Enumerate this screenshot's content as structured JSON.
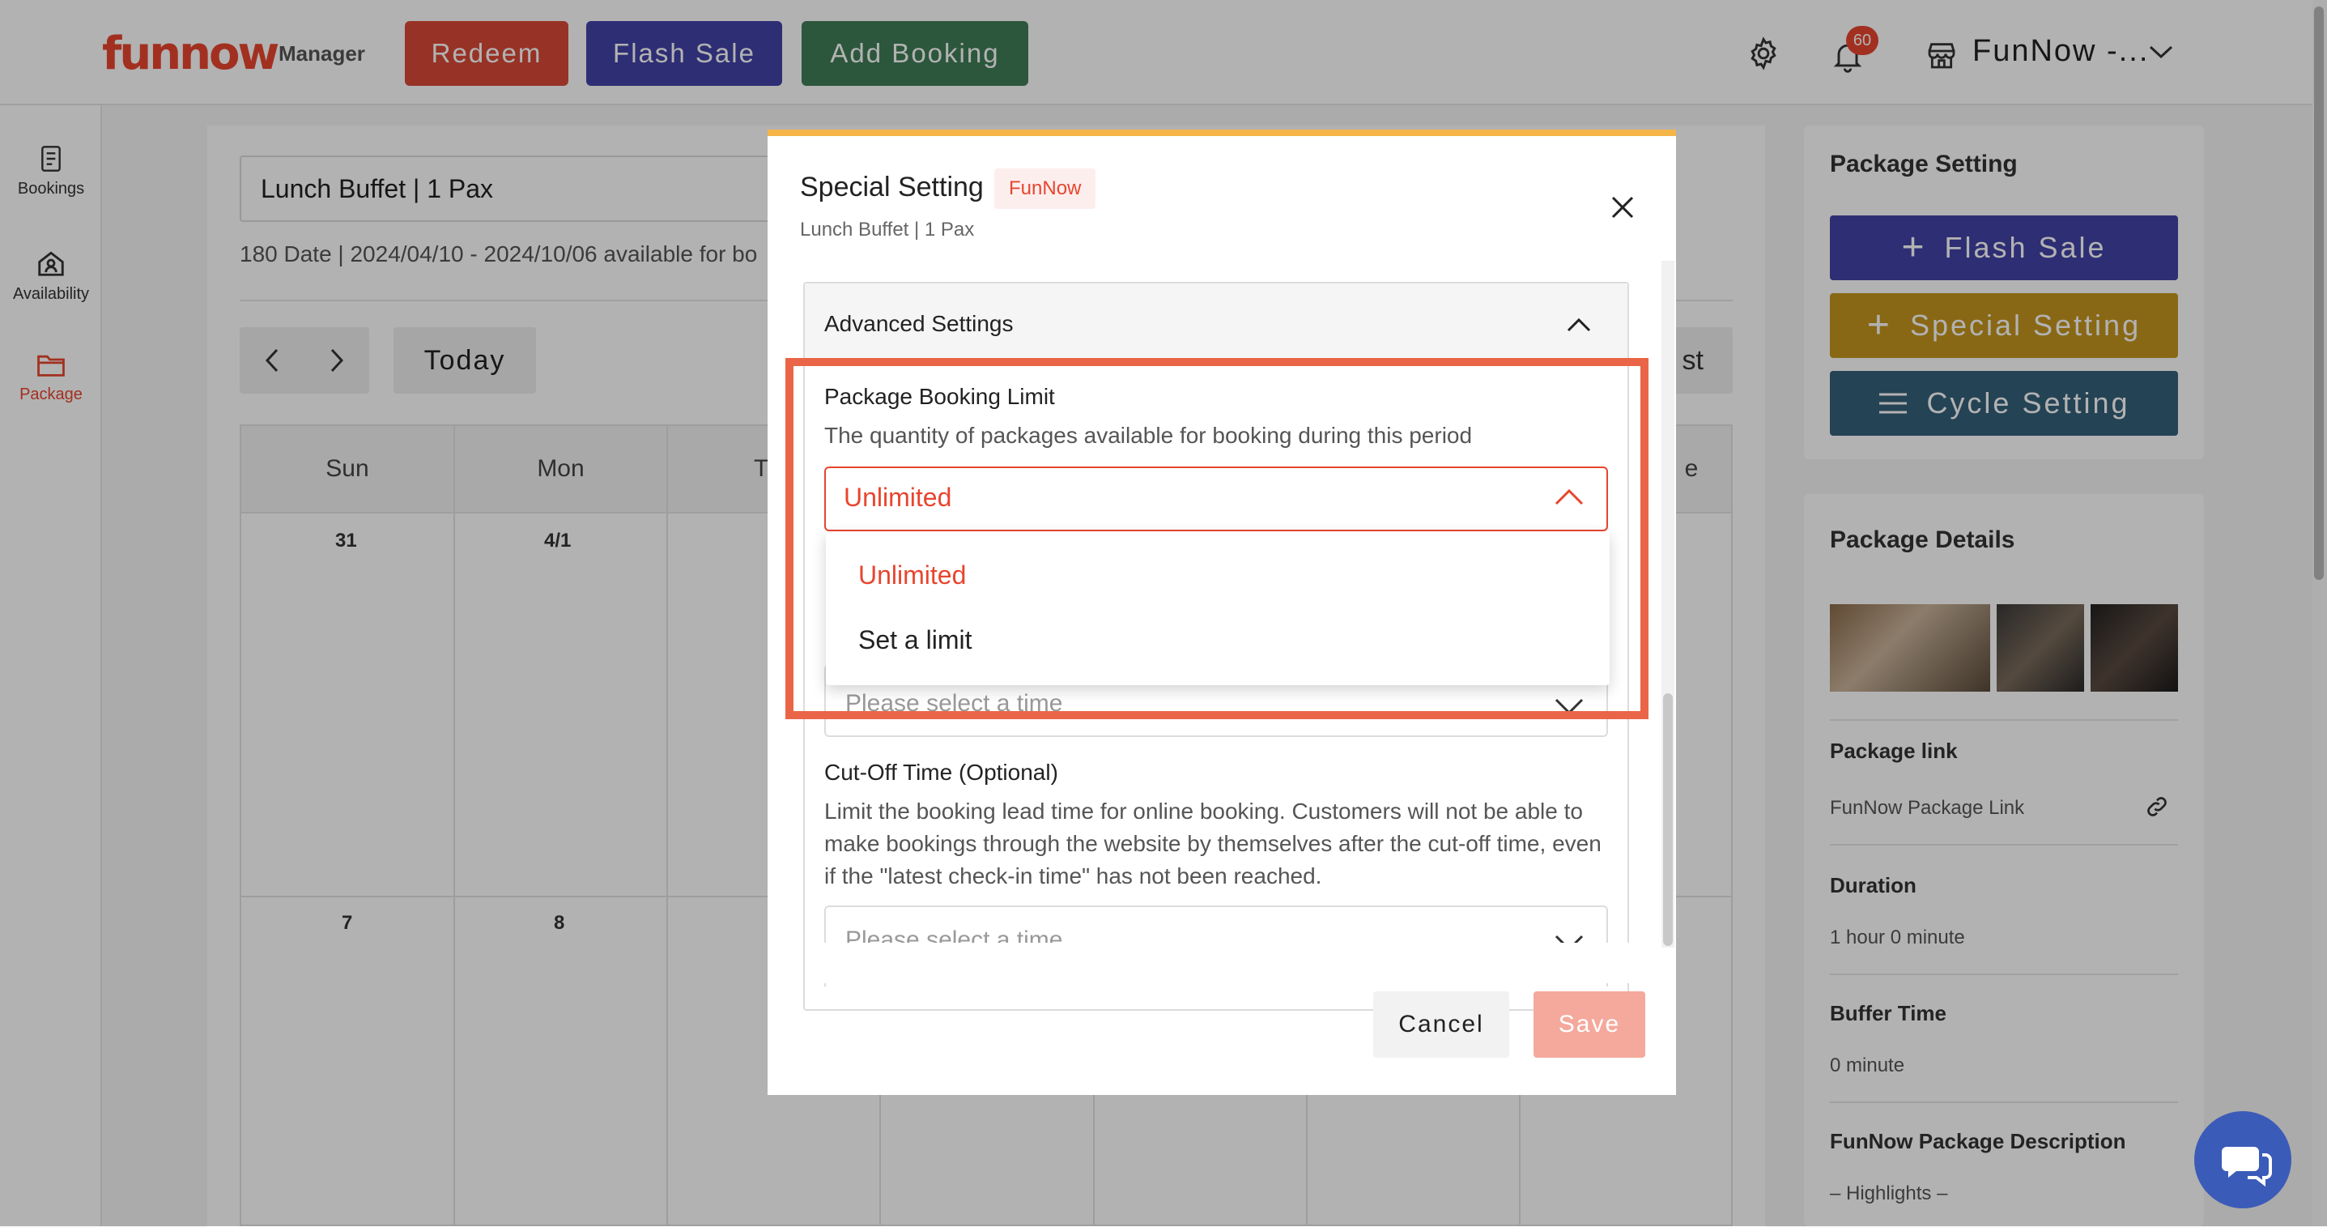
{
  "header": {
    "logo_text": "funnow",
    "logo_sub": "Manager",
    "buttons": {
      "redeem": "Redeem",
      "flash_sale": "Flash Sale",
      "add_booking": "Add Booking"
    },
    "notification_count": "60",
    "store_name": "FunNow -...",
    "colors": {
      "redeem": "#d94a37",
      "flash_sale": "#4343a8",
      "add_booking": "#3f7d57"
    }
  },
  "sidebar": {
    "items": [
      {
        "label": "Bookings",
        "icon": "document-icon"
      },
      {
        "label": "Availability",
        "icon": "home-user-icon"
      },
      {
        "label": "Package",
        "icon": "folder-icon",
        "active": true
      }
    ]
  },
  "calendar": {
    "package_select": "Lunch Buffet | 1 Pax",
    "date_info": "180 Date | 2024/04/10 - 2024/10/06 available for bo",
    "today_label": "Today",
    "right_control_text": "st",
    "day_headers": [
      "Sun",
      "Mon",
      "T",
      "",
      "",
      "",
      "e"
    ],
    "week1_dates": [
      "31",
      "4/1"
    ],
    "week2_dates": [
      "7",
      "8"
    ]
  },
  "right_panel": {
    "package_setting_title": "Package Setting",
    "flash_sale": "Flash Sale",
    "special_setting": "Special Setting",
    "cycle_setting": "Cycle Setting",
    "package_details_title": "Package Details",
    "package_link_label": "Package link",
    "package_link_value": "FunNow Package Link",
    "duration_label": "Duration",
    "duration_value": "1 hour 0 minute",
    "buffer_label": "Buffer Time",
    "buffer_value": "0 minute",
    "description_label": "FunNow Package Description",
    "description_value": "– Highlights –"
  },
  "modal": {
    "title": "Special Setting",
    "badge": "FunNow",
    "subtitle": "Lunch Buffet | 1 Pax",
    "advanced_settings": "Advanced Settings",
    "booking_limit_title": "Package Booking Limit",
    "booking_limit_desc": "The quantity of packages available for booking during this period",
    "booking_limit_value": "Unlimited",
    "options": [
      "Unlimited",
      "Set a limit"
    ],
    "time_placeholder": "Please select a time",
    "cutoff_title": "Cut-Off Time (Optional)",
    "cutoff_desc": "Limit the booking lead time for online booking. Customers will not be able to make bookings through the website by themselves after the cut-off time, even if the \"latest check-in time\" has not been reached.",
    "cutoff_placeholder": "Please select a time",
    "cancel": "Cancel",
    "save": "Save"
  },
  "colors": {
    "accent": "#e8452e",
    "highlight_border": "#ea6548"
  }
}
